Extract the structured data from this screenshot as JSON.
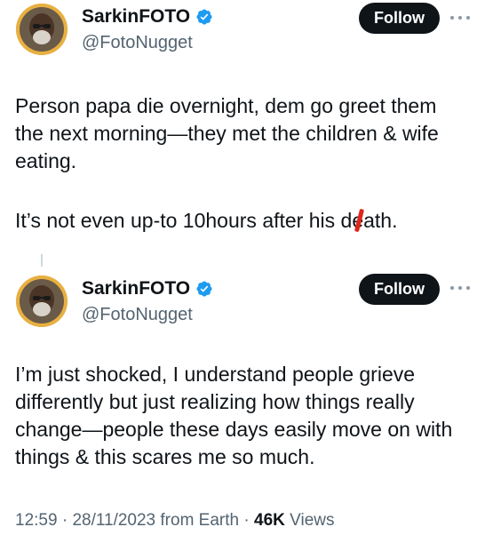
{
  "tweets": [
    {
      "author": {
        "display_name": "SarkinFOTO",
        "handle": "@FotoNugget",
        "verified": true,
        "avatar_icon": "avatar-icon"
      },
      "follow_label": "Follow",
      "text_paragraphs": [
        "Person papa die overnight, dem go greet them the next morning—they met the children & wife eating.",
        "It’s not even up-to 10hours after his death."
      ],
      "text_p2_parts": {
        "before": "It’s not even up-to 10hours after his d",
        "marked": "e",
        "after": "ath."
      }
    },
    {
      "author": {
        "display_name": "SarkinFOTO",
        "handle": "@FotoNugget",
        "verified": true,
        "avatar_icon": "avatar-icon"
      },
      "follow_label": "Follow",
      "text_paragraphs": [
        "I’m just shocked, I understand people grieve differently but just realizing how things really change—people these days easily move on with things & this scares me so much."
      ]
    }
  ],
  "meta": {
    "time": "12:59",
    "separator": "·",
    "date": "28/11/2023",
    "source": "from Earth",
    "views_count": "46K",
    "views_label": "Views"
  },
  "colors": {
    "text": "#0f1419",
    "secondary": "#536471",
    "verified": "#1d9bf0",
    "follow_bg": "#0f1419",
    "mark_red": "#e0251b"
  }
}
